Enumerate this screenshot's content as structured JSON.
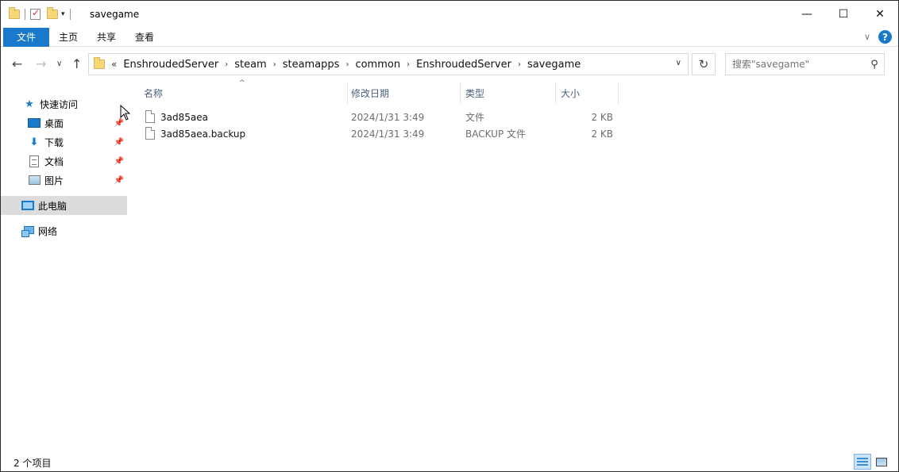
{
  "window": {
    "title": "savegame",
    "controls": {
      "minimize": "—",
      "maximize": "☐",
      "close": "✕"
    }
  },
  "ribbon": {
    "tabs": [
      {
        "label": "文件"
      },
      {
        "label": "主页"
      },
      {
        "label": "共享"
      },
      {
        "label": "查看"
      }
    ],
    "expand_glyph": "∨",
    "help_glyph": "?"
  },
  "nav": {
    "back": "←",
    "forward": "→",
    "recent": "∨",
    "up": "↑",
    "overflow": "«",
    "breadcrumbs": [
      "EnshroudedServer",
      "steam",
      "steamapps",
      "common",
      "EnshroudedServer",
      "savegame"
    ],
    "refresh": "↻",
    "search_placeholder": "搜索\"savegame\""
  },
  "sidebar": {
    "items": [
      {
        "label": "快速访问",
        "icon": "star-icon"
      },
      {
        "label": "桌面",
        "icon": "desktop-icon",
        "pinned": true
      },
      {
        "label": "下载",
        "icon": "download-icon",
        "pinned": true
      },
      {
        "label": "文档",
        "icon": "document-icon",
        "pinned": true
      },
      {
        "label": "图片",
        "icon": "picture-icon",
        "pinned": true
      },
      {
        "label": "此电脑",
        "icon": "computer-icon",
        "selected": true
      },
      {
        "label": "网络",
        "icon": "network-icon"
      }
    ]
  },
  "list": {
    "columns": {
      "name": "名称",
      "date": "修改日期",
      "type": "类型",
      "size": "大小"
    },
    "sort_glyph": "^",
    "rows": [
      {
        "name": "3ad85aea",
        "date": "2024/1/31 3:49",
        "type": "文件",
        "size": "2 KB"
      },
      {
        "name": "3ad85aea.backup",
        "date": "2024/1/31 3:49",
        "type": "BACKUP 文件",
        "size": "2 KB"
      }
    ]
  },
  "status": {
    "item_count": "2 个项目"
  },
  "colors": {
    "accent": "#1979ca",
    "selected_bg": "#dcdcdc",
    "folder": "#f8d775"
  }
}
